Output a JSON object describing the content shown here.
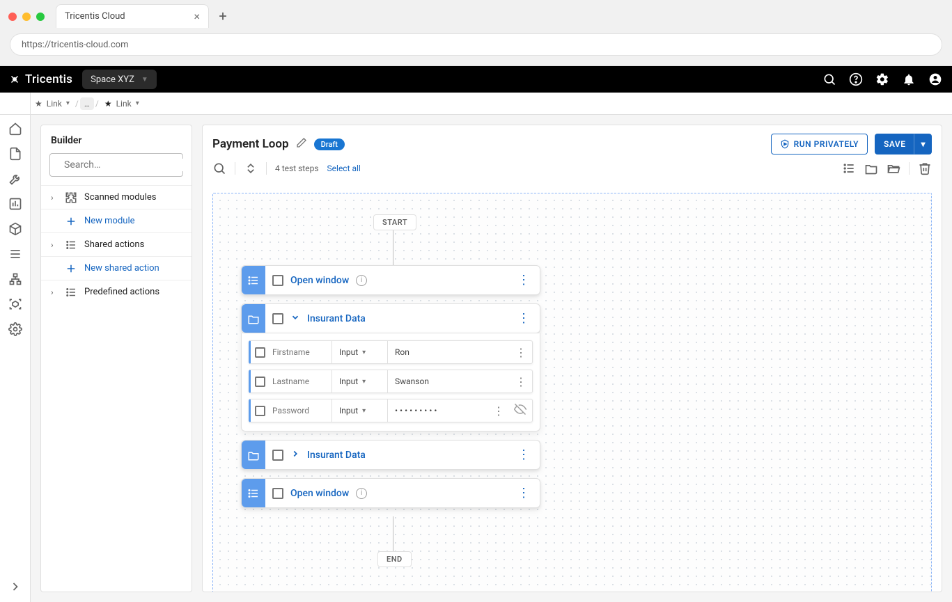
{
  "browser": {
    "tab_title": "Tricentis Cloud",
    "url": "https://tricentis-cloud.com"
  },
  "header": {
    "brand": "Tricentis",
    "space_label": "Space XYZ"
  },
  "breadcrumb": {
    "link1": "Link",
    "ellipsis": "…",
    "link2": "Link"
  },
  "builder": {
    "title": "Builder",
    "search_placeholder": "Search…",
    "rows": {
      "scanned_modules": "Scanned modules",
      "new_module": "New module",
      "shared_actions": "Shared actions",
      "new_shared_action": "New shared action",
      "predefined_actions": "Predefined actions"
    }
  },
  "main": {
    "title": "Payment Loop",
    "status_badge": "Draft",
    "run_privately": "RUN PRIVATELY",
    "save": "SAVE",
    "steps_count": "4 test steps",
    "select_all": "Select all"
  },
  "flow": {
    "start": "START",
    "end": "END",
    "step1": {
      "label": "Open window"
    },
    "step2": {
      "label": "Insurant Data",
      "fields": [
        {
          "name": "Firstname",
          "type": "Input",
          "value": "Ron"
        },
        {
          "name": "Lastname",
          "type": "Input",
          "value": "Swanson"
        },
        {
          "name": "Password",
          "type": "Input",
          "value": "•••••••••"
        }
      ]
    },
    "step3": {
      "label": "Insurant Data"
    },
    "step4": {
      "label": "Open window"
    }
  }
}
